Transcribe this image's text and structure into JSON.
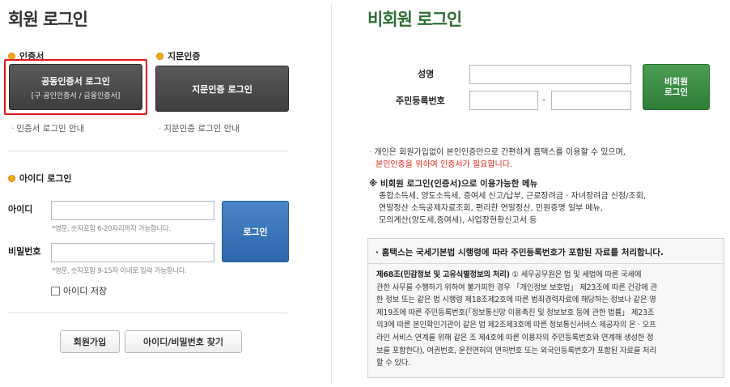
{
  "member": {
    "title": "회원 로그인",
    "cert_section": {
      "label": "인증서",
      "button_main": "공동인증서 로그인",
      "button_sub": "[구 공인인증서 / 금융인증서]",
      "guide": "인증서 로그인 안내"
    },
    "finger_section": {
      "label": "지문인증",
      "button": "지문인증 로그인",
      "guide": "지문인증 로그인 안내"
    },
    "id_section": {
      "label": "아이디 로그인",
      "id_label": "아이디",
      "id_value": "",
      "id_hint": "*영문, 숫자포함 6-20자리까지 가능합니다.",
      "pw_label": "비밀번호",
      "pw_value": "",
      "pw_hint": "*영문, 숫자포함 9-15자 이내로 입력 가능합니다.",
      "login_button": "로그인",
      "remember_label": "아이디 저장",
      "remember_checked": false
    },
    "bottom_buttons": {
      "join": "회원가입",
      "find": "아이디/비밀번호 찾기"
    }
  },
  "guest": {
    "title": "비회원 로그인",
    "name_label": "성명",
    "name_value": "",
    "rrn_label": "주민등록번호",
    "rrn_first": "",
    "rrn_separator": "-",
    "rrn_second": "",
    "login_button_line1": "비회원",
    "login_button_line2": "로그인",
    "info_line1": "개인은 회원가입없이 본인인증만으로 간편하게 홈택스를 이용할 수 있으며,",
    "info_line2_red": "본인인증을 위하여 인증서가 필요합니다.",
    "menu_title": "※ 비회원 로그인(인증서)으로 이용가능한 메뉴",
    "menu_lines": [
      "종합소득세, 양도소득세, 증여세 신고/납부, 근로장려금 · 자녀장려금 신청/조회,",
      "연말정산 소득공제자료조회, 편리한 연말정산, 민원증명 일부 메뉴,",
      "모의계산(양도세,증여세), 사업장현황신고서 등"
    ],
    "law_box": {
      "heading": "· 홈택스는 국세기본법 시행령에 따라 주민등록번호가 포함된 자료를 처리합니다.",
      "article_title": "제68조(민감정보 및 고유식별정보의 처리)",
      "body_lines": [
        "① 세무공무원은 법 및 세법에 따른 국세에",
        "관한 사무를 수행하기 위하여 불가피한 경우 「개인정보 보호법」 제23조에 따른 건강에 관",
        "한 정보 또는 같은 법 시행령 제18조제2호에 따른 범죄경력자료에 해당하는 정보나 같은 영",
        "제19조에 따른 주민등록번호(「정보통신망 이용촉진 및 정보보호 등에 관한 법률」 제23조",
        "의3에 따른 본인확인기관이 같은 법 제2조제3호에 따른 정보통신서비스 제공자의 온 · 오프",
        "라인 서비스 연계를 위해 같은 조 제4호에 따른 이용자의 주민등록번호와 연계해 생성한 정",
        "보를 포함한다), 여권번호, 운전면허의 면허번호 또는 외국인등록번호가 포함된 자료를 처리",
        "할 수 있다."
      ]
    }
  },
  "colors": {
    "member_title": "#333333",
    "guest_title": "#2e6e34",
    "cert_highlight": "#e0161b",
    "blue_button": "#2d66aa",
    "green_button": "#2f7d38",
    "bullet": "#f0a81c"
  },
  "icons": {
    "section_bullet": "orange-dot-icon"
  }
}
